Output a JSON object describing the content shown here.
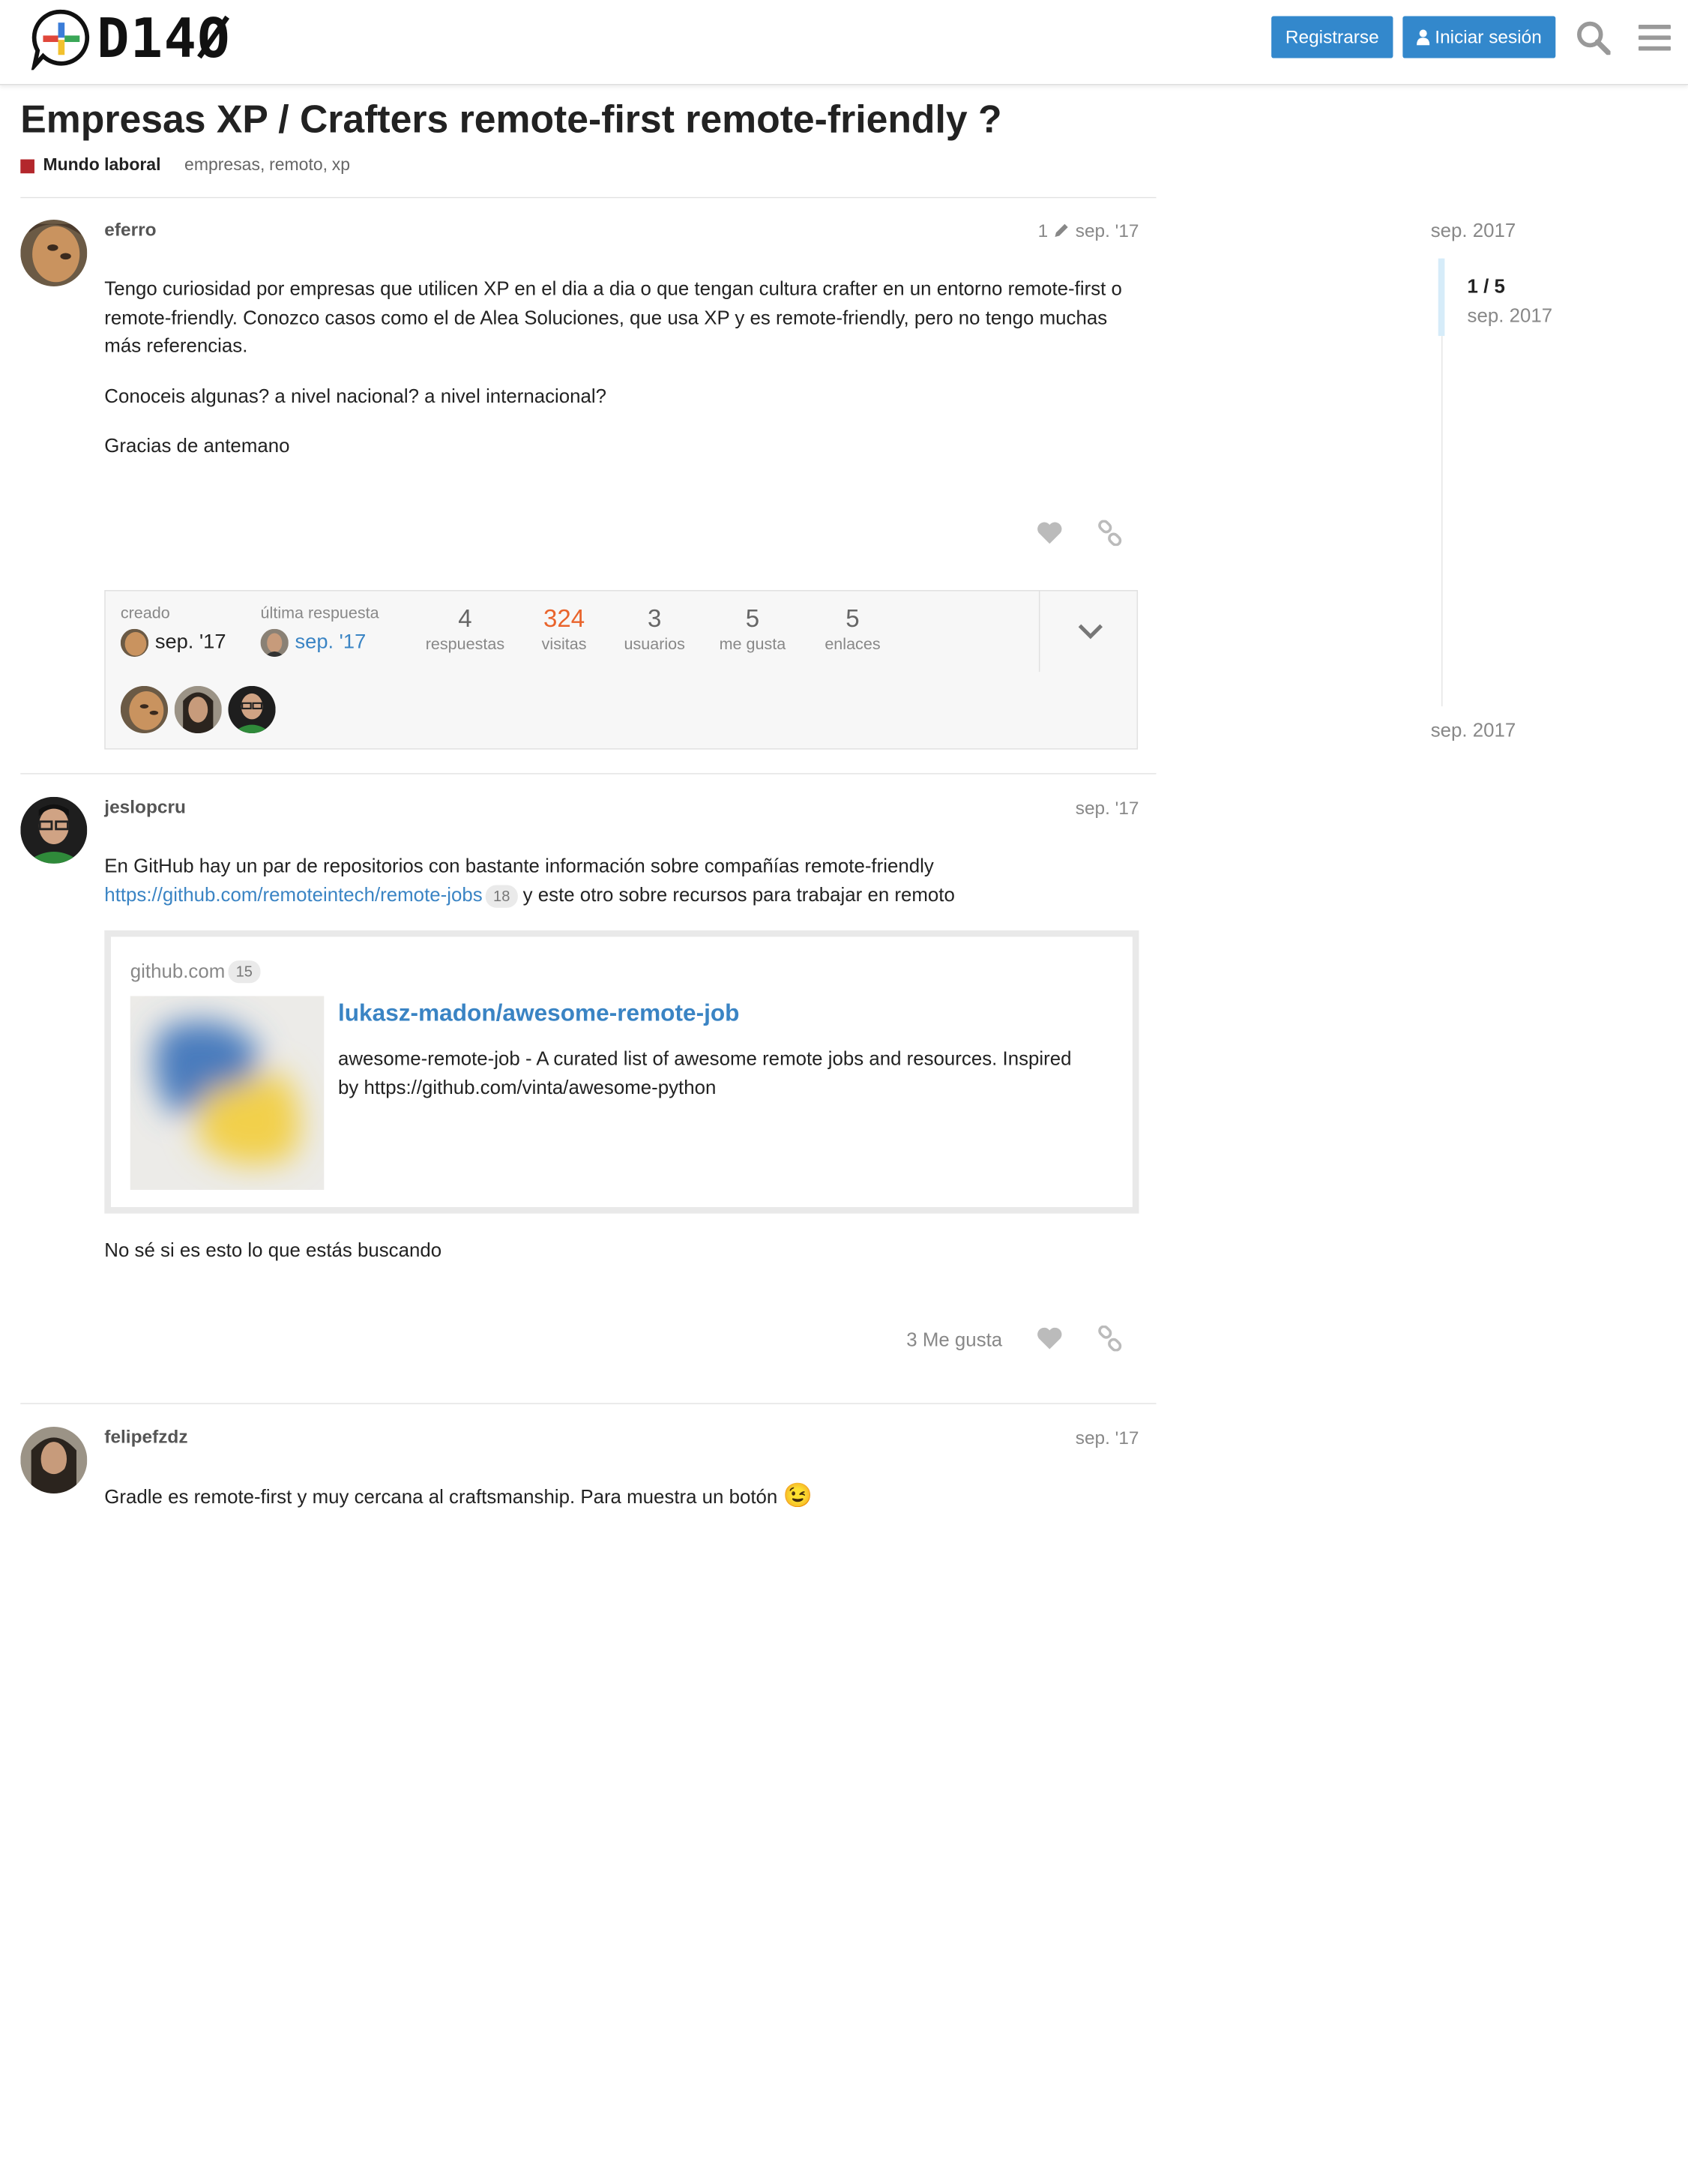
{
  "header": {
    "logo_text": "D14Ø",
    "register_label": "Registrarse",
    "login_label": "Iniciar sesión",
    "accent_color": "#3388cc"
  },
  "topic": {
    "title": "Empresas XP / Crafters remote-first remote-friendly ?",
    "category": "Mundo laboral",
    "category_color": "#b3272c",
    "tags": [
      "empresas",
      "remoto",
      "xp"
    ]
  },
  "posts": [
    {
      "username": "eferro",
      "edit_count": "1",
      "date": "sep. '17",
      "paragraphs": [
        "Tengo curiosidad por empresas que utilicen XP en el dia a dia o que tengan cultura crafter en un entorno remote-first o remote-friendly. Conozco casos como el de Alea Soluciones, que usa XP y es remote-friendly, pero no tengo muchas más referencias.",
        "Conoceis algunas? a nivel nacional? a nivel internacional?",
        "Gracias de antemano"
      ]
    },
    {
      "username": "jeslopcru",
      "date": "sep. '17",
      "text_before": "En GitHub hay un par de repositorios con bastante información sobre compañías remote-friendly",
      "link_url": "https://github.com/remoteintech/remote-jobs",
      "link_clicks": "18",
      "text_after": "y este otro sobre recursos para trabajar en remoto",
      "onebox": {
        "source": "github.com",
        "source_clicks": "15",
        "title": "lukasz-madon/awesome-remote-job",
        "description": "awesome-remote-job - A curated list of awesome remote jobs and resources. Inspired by https://github.com/vinta/awesome-python"
      },
      "closing_text": "No sé si es esto lo que estás buscando",
      "likes_label": "3 Me gusta"
    },
    {
      "username": "felipefzdz",
      "date": "sep. '17",
      "text": "Gradle es remote-first y muy cercana al craftsmanship. Para muestra un botón",
      "emoji": "😉"
    }
  ],
  "topic_map": {
    "created_label": "creado",
    "created_date": "sep. '17",
    "last_reply_label": "última respuesta",
    "last_reply_date": "sep. '17",
    "stats": [
      {
        "value": "4",
        "label": "respuestas"
      },
      {
        "value": "324",
        "label": "visitas"
      },
      {
        "value": "3",
        "label": "usuarios"
      },
      {
        "value": "5",
        "label": "me gusta"
      },
      {
        "value": "5",
        "label": "enlaces"
      }
    ]
  },
  "timeline": {
    "top_date": "sep. 2017",
    "count": "1 / 5",
    "current_date": "sep. 2017",
    "bottom_date": "sep. 2017"
  }
}
